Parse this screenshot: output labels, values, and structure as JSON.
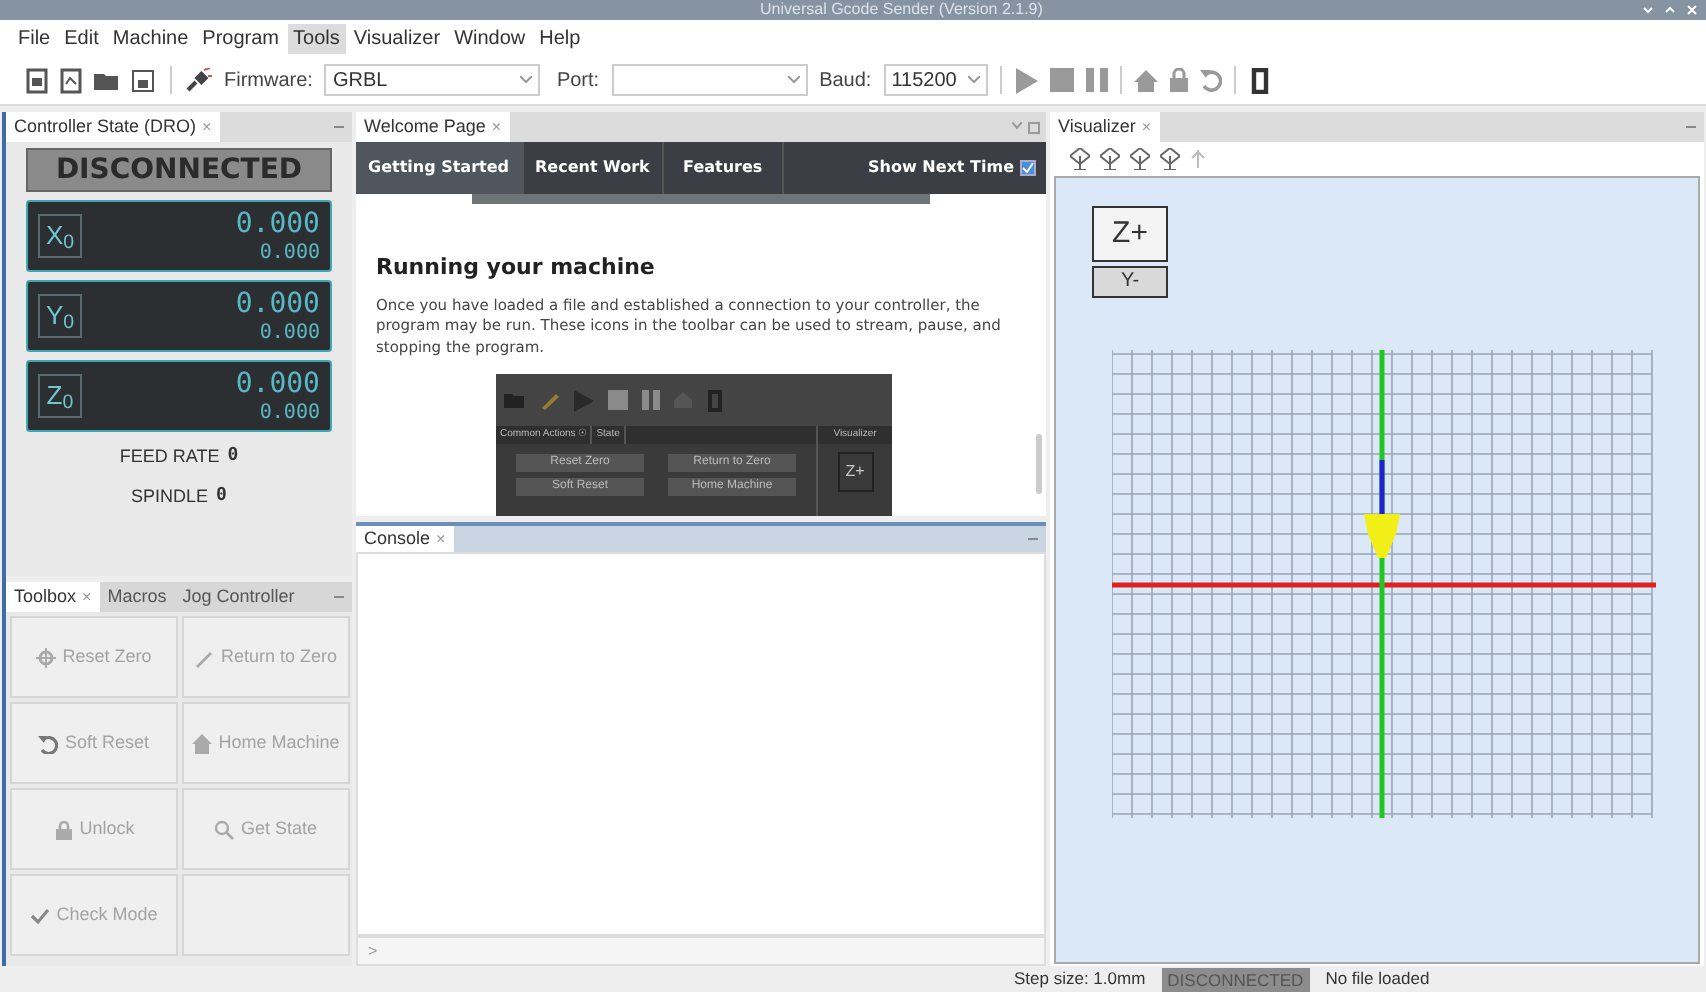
{
  "window": {
    "title": "Universal Gcode Sender (Version 2.1.9)"
  },
  "menu": [
    {
      "label": "File",
      "selected": false
    },
    {
      "label": "Edit",
      "selected": false
    },
    {
      "label": "Machine",
      "selected": false
    },
    {
      "label": "Program",
      "selected": false
    },
    {
      "label": "Tools",
      "selected": true
    },
    {
      "label": "Visualizer",
      "selected": false
    },
    {
      "label": "Window",
      "selected": false
    },
    {
      "label": "Help",
      "selected": false
    }
  ],
  "toolbar": {
    "firmware_label": "Firmware:",
    "firmware": "GRBL",
    "port_label": "Port:",
    "baud_label": "Baud:",
    "baud": "115200"
  },
  "dro": {
    "tab": "Controller State (DRO)",
    "close": "×",
    "state": "DISCONNECTED",
    "axes": [
      {
        "axis": "X$_{0}$",
        "work": "0.000",
        "machine": "0.000"
      },
      {
        "axis": "Y$_{0}$",
        "work": "0.000",
        "machine": "0.000"
      },
      {
        "axis": "Z$_{0}$",
        "work": "0.000",
        "machine": "0.000"
      }
    ],
    "feed_rate_label": "FEED RATE",
    "feed_rate": "0",
    "spindle_label": "SPINDLE",
    "spindle": "0"
  },
  "toolbox": {
    "tabs": [
      {
        "label": "Toolbox",
        "close": "×",
        "selected": true
      },
      {
        "label": "Macros",
        "selected": false
      },
      {
        "label": "Jog Controller",
        "selected": false
      }
    ],
    "buttons": [
      {
        "kind": "reset-zero",
        "label": "Reset Zero",
        "disabled": true
      },
      {
        "kind": "return-zero",
        "label": "Return to Zero",
        "disabled": true
      },
      {
        "kind": "soft-reset",
        "label": "Soft Reset",
        "disabled": true
      },
      {
        "kind": "home",
        "label": "Home Machine",
        "disabled": true
      },
      {
        "kind": "unlock",
        "label": "Unlock",
        "disabled": true
      },
      {
        "kind": "get-state",
        "label": "Get State",
        "disabled": true
      },
      {
        "kind": "check",
        "label": "Check Mode",
        "disabled": true
      }
    ]
  },
  "welcome": {
    "tab": "Welcome Page",
    "close": "×",
    "nav": [
      {
        "label": "Getting Started",
        "selected": true
      },
      {
        "label": "Recent Work",
        "selected": false
      },
      {
        "label": "Features",
        "selected": false
      }
    ],
    "show_next_time": {
      "label": "Show Next Time",
      "checked": true
    },
    "heading": "Running your machine",
    "paragraph": "Once you have loaded a file and established a connection to your controller, the program may be run. These icons in the toolbar can be used to stream, pause, and stopping the program.",
    "screenshot": {
      "tabs": [
        "Common Actions ☉",
        "State"
      ],
      "side_tab": "Visualizer",
      "buttons": [
        "Reset Zero",
        "Return to Zero",
        "Soft Reset",
        "Home Machine"
      ],
      "axis_button": "Z+"
    }
  },
  "console": {
    "tab": "Console",
    "close": "×",
    "prompt": ">"
  },
  "visualizer": {
    "tab": "Visualizer",
    "close": "×",
    "view_cube": [
      "Z+",
      "Y-"
    ]
  },
  "status_bar": {
    "step_size": "Step size: 1.0mm",
    "state": "DISCONNECTED",
    "file": "No file loaded"
  }
}
